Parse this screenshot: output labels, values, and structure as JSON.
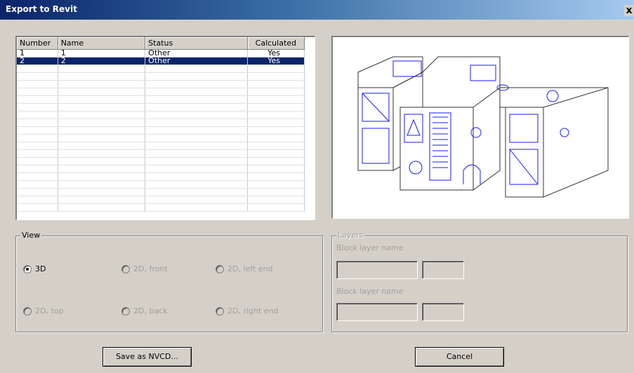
{
  "window": {
    "title": "Export to Revit",
    "close_label": "x"
  },
  "table": {
    "columns": [
      "Number",
      "Name",
      "Status",
      "Calculated"
    ],
    "rows": [
      {
        "number": "1",
        "name": "1",
        "status": "Other",
        "calculated": "Yes",
        "selected": false
      },
      {
        "number": "2",
        "name": "2",
        "status": "Other",
        "calculated": "Yes",
        "selected": true
      }
    ],
    "empty_rows": 19
  },
  "view": {
    "label": "View",
    "options": [
      {
        "label": "3D",
        "checked": true,
        "enabled": true
      },
      {
        "label": "2D, front",
        "checked": false,
        "enabled": false
      },
      {
        "label": "2D, left end",
        "checked": false,
        "enabled": false
      },
      {
        "label": "2D, top",
        "checked": false,
        "enabled": false
      },
      {
        "label": "2D, back",
        "checked": false,
        "enabled": false
      },
      {
        "label": "2D, right end",
        "checked": false,
        "enabled": false
      }
    ]
  },
  "layers": {
    "label": "Layers",
    "block_label_1": "Block layer name",
    "block_label_2": "Block layer name"
  },
  "buttons": {
    "save": "Save as NVCD...",
    "cancel": "Cancel"
  },
  "colors": {
    "selection": "#0a246a",
    "drawing_blue": "#1a1aff"
  }
}
